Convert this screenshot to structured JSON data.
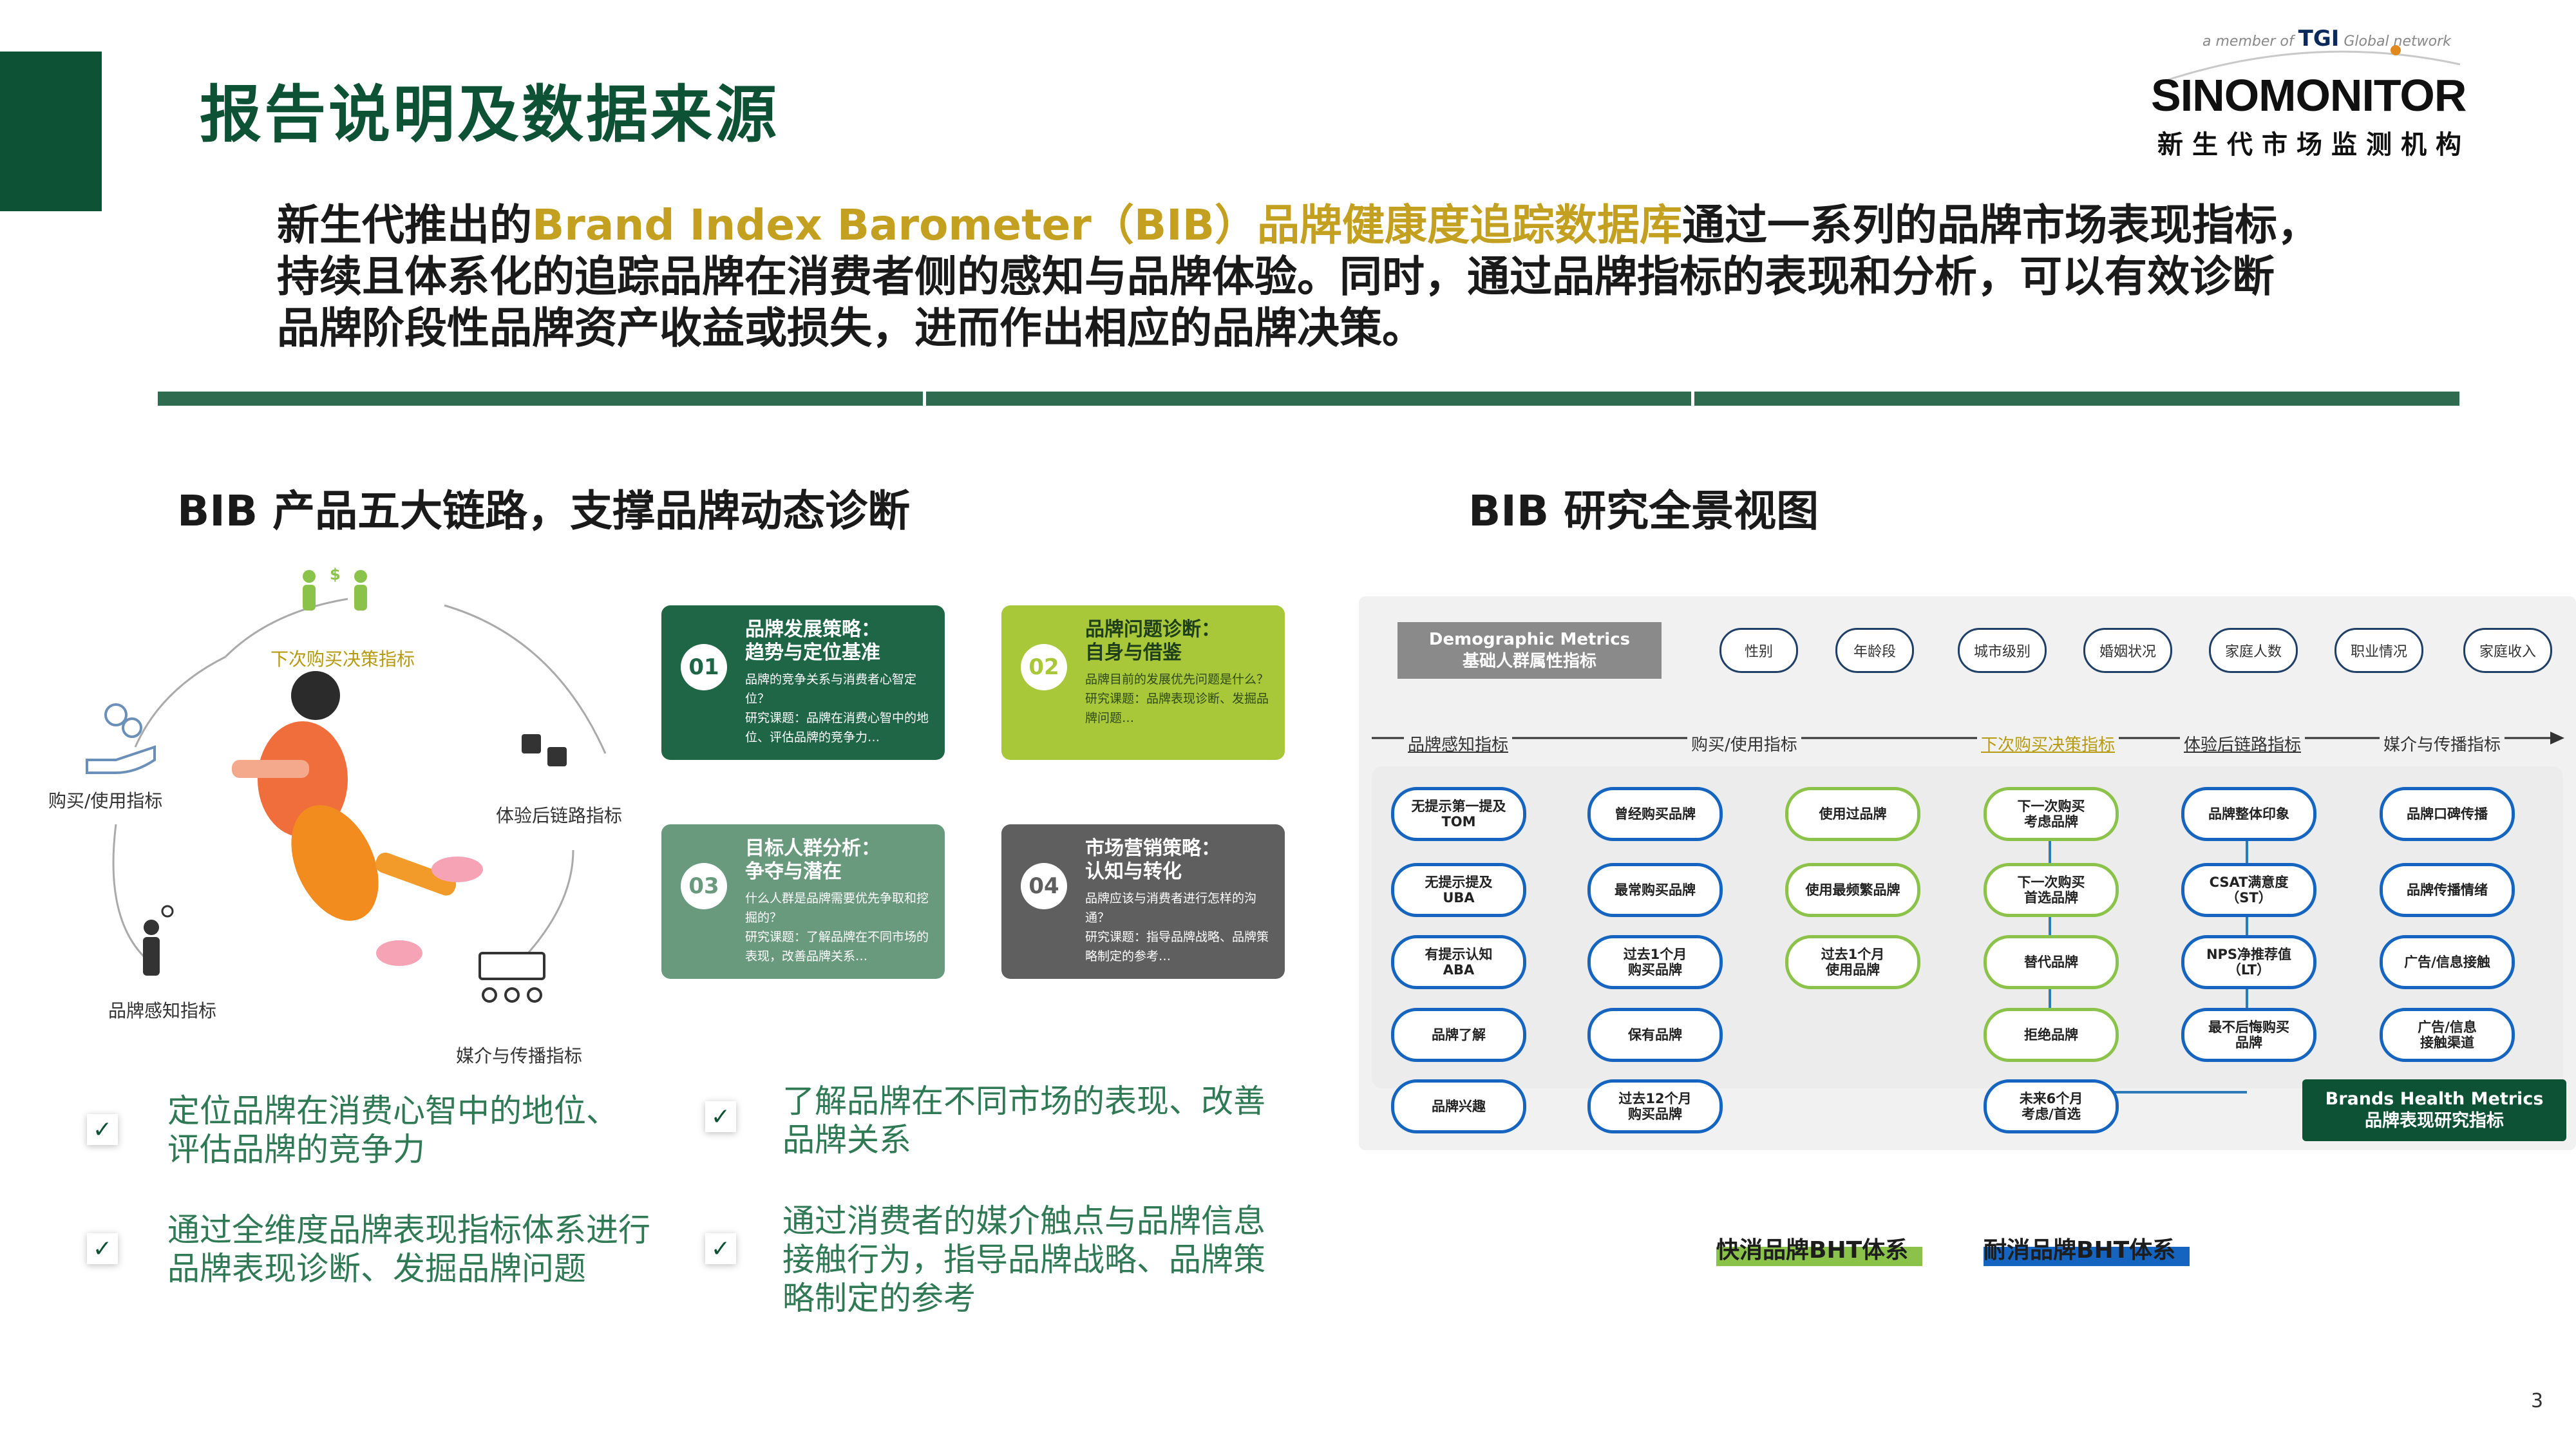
{
  "page": {
    "title": "报告说明及数据来源",
    "page_number": "3"
  },
  "logo": {
    "member_prefix": "a member of",
    "tgi": "TGI",
    "network": "Global network",
    "name": "SINOMONITOR",
    "subtitle": "新生代市场监测机构"
  },
  "intro": {
    "line1_pre": "新生代推出的",
    "line1_hl": "Brand Index Barometer（BIB）品牌健康度追踪数据库",
    "line1_post": "通过一系列的品牌市场表现指标，",
    "line2": "持续且体系化的追踪品牌在消费者侧的感知与品牌体验。同时，通过品牌指标的表现和分析，可以有效诊断",
    "line3": "品牌阶段性品牌资产收益或损失，进而作出相应的品牌决策。"
  },
  "left": {
    "section_title": "BIB  产品五大链路，支撑品牌动态诊断",
    "cycle": {
      "top": "下次购买决策指标",
      "right": "体验后链路指标",
      "bottom_right": "媒介与传播指标",
      "bottom_left": "品牌感知指标",
      "left": "购买/使用指标"
    },
    "cards": [
      {
        "num": "01",
        "title1": "品牌发展策略：",
        "title2": "趋势与定位基准",
        "body1": "品牌的竞争关系与消费者心智定位？",
        "body2": "研究课题：品牌在消费心智中的地位、评估品牌的竞争力…",
        "color": "#1f6647"
      },
      {
        "num": "02",
        "title1": "品牌问题诊断：",
        "title2": "自身与借鉴",
        "body1": "品牌目前的发展优先问题是什么？",
        "body2": "研究课题：品牌表现诊断、发掘品牌问题…",
        "color": "#a8c83a"
      },
      {
        "num": "03",
        "title1": "目标人群分析：",
        "title2": "争夺与潜在",
        "body1": "什么人群是品牌需要优先争取和挖掘的？",
        "body2": "研究课题：了解品牌在不同市场的表现，改善品牌关系…",
        "color": "#6a9a7e"
      },
      {
        "num": "04",
        "title1": "市场营销策略：",
        "title2": "认知与转化",
        "body1": "品牌应该与消费者进行怎样的沟通？",
        "body2": "研究课题：指导品牌战略、品牌策略制定的参考…",
        "color": "#5f5f5f"
      }
    ],
    "bullets": [
      {
        "line1": "定位品牌在消费心智中的地位、",
        "line2": "评估品牌的竞争力",
        "line3": ""
      },
      {
        "line1": "了解品牌在不同市场的表现、改善",
        "line2": "品牌关系",
        "line3": ""
      },
      {
        "line1": "通过全维度品牌表现指标体系进行",
        "line2": "品牌表现诊断、发掘品牌问题",
        "line3": ""
      },
      {
        "line1": "通过消费者的媒介触点与品牌信息",
        "line2": "接触行为，指导品牌战略、品牌策",
        "line3": "略制定的参考"
      }
    ]
  },
  "right": {
    "section_title": "BIB  研究全景视图",
    "demographic": {
      "en": "Demographic Metrics",
      "cn": "基础人群属性指标"
    },
    "demographic_pills": [
      "性别",
      "年龄段",
      "城市级别",
      "婚姻状况",
      "家庭人数",
      "职业情况",
      "家庭收入"
    ],
    "chains": [
      "品牌感知指标",
      "购买/使用指标",
      "下次购买决策指标",
      "体验后链路指标",
      "媒介与传播指标"
    ],
    "columns": [
      {
        "border": "#1565c0",
        "nodes": [
          [
            "无提示第一提及",
            "TOM"
          ],
          [
            "无提示提及",
            "UBA"
          ],
          [
            "有提示认知",
            "ABA"
          ],
          [
            "品牌了解",
            ""
          ],
          [
            "品牌兴趣",
            ""
          ]
        ]
      },
      {
        "border": "#1565c0",
        "nodes": [
          [
            "曾经购买品牌",
            ""
          ],
          [
            "最常购买品牌",
            ""
          ],
          [
            "过去1个月",
            "购买品牌"
          ],
          [
            "保有品牌",
            ""
          ],
          [
            "过去12个月",
            "购买品牌"
          ]
        ]
      },
      {
        "border": "#8bc34a",
        "nodes": [
          [
            "使用过品牌",
            ""
          ],
          [
            "使用最频繁品牌",
            ""
          ],
          [
            "过去1个月",
            "使用品牌"
          ]
        ]
      },
      {
        "border": "#8bc34a",
        "nodes": [
          [
            "下一次购买",
            "考虑品牌"
          ],
          [
            "下一次购买",
            "首选品牌"
          ],
          [
            "替代品牌",
            ""
          ],
          [
            "拒绝品牌",
            ""
          ],
          [
            "未来6个月",
            "考虑/首选"
          ]
        ]
      },
      {
        "border": "#1565c0",
        "nodes": [
          [
            "品牌整体印象",
            ""
          ],
          [
            "CSAT满意度",
            "（ST）"
          ],
          [
            "NPS净推荐值",
            "（LT）"
          ],
          [
            "最不后悔购买",
            "品牌"
          ]
        ]
      },
      {
        "border": "#1565c0",
        "nodes": [
          [
            "品牌口碑传播",
            ""
          ],
          [
            "品牌传播情绪",
            ""
          ],
          [
            "广告/信息接触",
            ""
          ],
          [
            "广告/信息",
            "接触渠道"
          ]
        ]
      }
    ],
    "bht": {
      "en": "Brands Health Metrics",
      "cn": "品牌表现研究指标"
    },
    "legend": [
      {
        "label": "快消品牌BHT体系",
        "color": "#8bc34a"
      },
      {
        "label": "耐消品牌BHT体系",
        "color": "#1565c0"
      }
    ]
  }
}
